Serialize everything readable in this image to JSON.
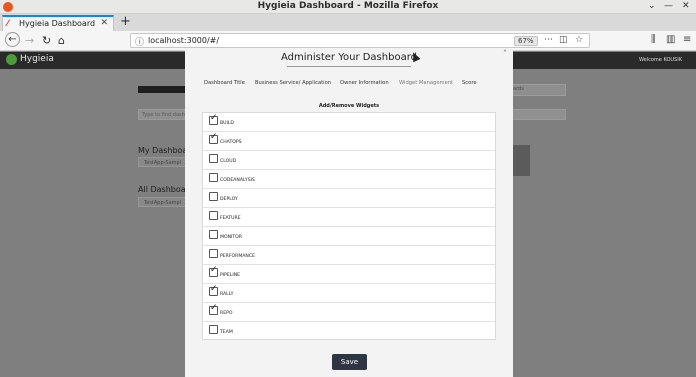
{
  "window": {
    "title": "Hygieia Dashboard - Mozilla Firefox",
    "controls": [
      "⌄",
      "—",
      "✕"
    ]
  },
  "tabbar": {
    "tab_label": "Hygieia Dashboard",
    "new_tab": "+"
  },
  "navbar": {
    "url": "localhost:3000/#/",
    "zoom": "67%"
  },
  "app": {
    "brand": "Hygieia",
    "welcome": "Welcome KOUSIK"
  },
  "background": {
    "search_placeholder": "Type to find dash",
    "my_dashboards": "My Dashboar",
    "all_dashboards": "All Dashboar",
    "item_label": "TestApp-Sampl",
    "right_label": "ards"
  },
  "modal": {
    "title": "Administer Your Dashboard",
    "tabs": [
      {
        "label": "Dashboard Title"
      },
      {
        "label": "Business Service/ Application"
      },
      {
        "label": "Owner Information"
      },
      {
        "label": "Widget Management"
      },
      {
        "label": "Score"
      }
    ],
    "subheading": "Add/Remove Widgets",
    "widgets": [
      {
        "label": "BUILD",
        "checked": true
      },
      {
        "label": "CHATOPS",
        "checked": true
      },
      {
        "label": "CLOUD",
        "checked": false
      },
      {
        "label": "CODEANALYSIS",
        "checked": false
      },
      {
        "label": "DEPLOY",
        "checked": false
      },
      {
        "label": "FEATURE",
        "checked": false
      },
      {
        "label": "MONITOR",
        "checked": false
      },
      {
        "label": "PERFORMANCE",
        "checked": false
      },
      {
        "label": "PIPELINE",
        "checked": true
      },
      {
        "label": "RALLY",
        "checked": true
      },
      {
        "label": "REPO",
        "checked": true
      },
      {
        "label": "TEAM",
        "checked": false
      }
    ],
    "save_label": "Save"
  }
}
